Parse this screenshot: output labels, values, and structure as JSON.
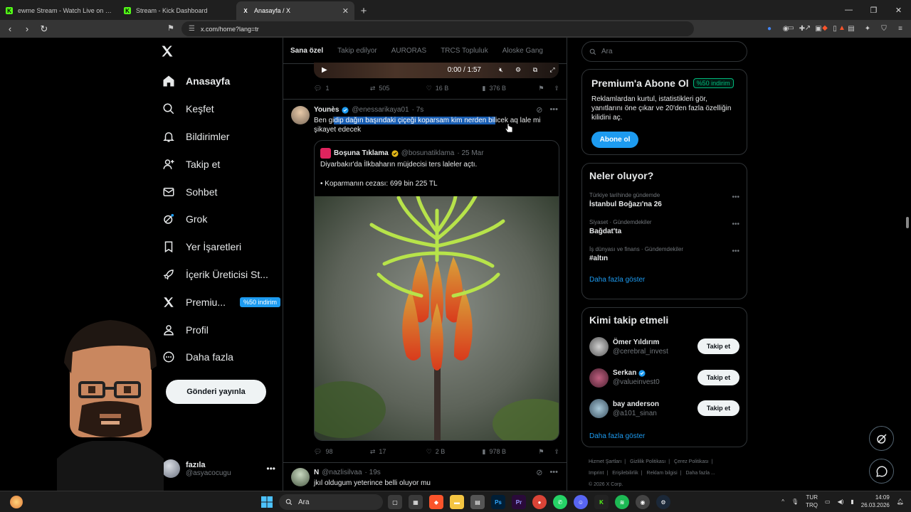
{
  "browser": {
    "tabs": [
      {
        "label": "ewme Stream - Watch Live on Kick",
        "fav_color": "#53fc18",
        "fav": "K"
      },
      {
        "label": "Stream - Kick Dashboard",
        "fav_color": "#53fc18",
        "fav": "K"
      },
      {
        "label": "Anasayfa / X",
        "fav_color": "#ffffff",
        "fav": "X"
      }
    ],
    "url": "x.com/home?lang=tr"
  },
  "nav": {
    "items": [
      {
        "label": "Anasayfa",
        "icon": "home-icon"
      },
      {
        "label": "Keşfet",
        "icon": "search-icon"
      },
      {
        "label": "Bildirimler",
        "icon": "bell-icon"
      },
      {
        "label": "Takip et",
        "icon": "add-user-icon"
      },
      {
        "label": "Sohbet",
        "icon": "mail-icon"
      },
      {
        "label": "Grok",
        "icon": "grok-icon"
      },
      {
        "label": "Yer İşaretleri",
        "icon": "bookmark-icon"
      },
      {
        "label": "İçerik Üreticisi St...",
        "icon": "rocket-icon"
      },
      {
        "label": "Premiu...",
        "icon": "x-icon"
      },
      {
        "label": "Profil",
        "icon": "person-icon"
      },
      {
        "label": "Daha fazla",
        "icon": "more-icon"
      }
    ],
    "premium_badge": "%50 indirim",
    "post_button": "Gönderi yayınla",
    "profile": {
      "name": "fazıla",
      "handle": "@asyacocugu"
    }
  },
  "feed": {
    "tabs": [
      "Sana özel",
      "Takip edilyor",
      "AURORAS",
      "TRCS Topluluk",
      "Aloske Gang"
    ],
    "video": {
      "time": "0:00 / 1:57"
    },
    "top_actions": {
      "replies": "1",
      "reposts": "505",
      "likes": "16 B",
      "views": "376 B"
    },
    "tweet": {
      "name": "Younès",
      "handle": "@enessarikaya01",
      "time": "· 7s",
      "text_pre": "Ben gi",
      "text_hl": "dip dağın başındaki çiçeği koparsam kim nerden bil",
      "text_post": "icek aq lale mi şikayet edecek",
      "quote": {
        "name": "Boşuna Tıklama",
        "handle": "@bosunatiklama",
        "time": "· 25 Mar",
        "line1": "Diyarbakır'da İlkbaharın müjdecisi ters laleler açtı.",
        "line2": "• Koparmanın cezası: 699 bin 225 TL"
      },
      "actions": {
        "replies": "98",
        "reposts": "17",
        "likes": "2 B",
        "views": "978 B"
      }
    },
    "next_tweet": {
      "name": "N",
      "handle": "@nazlisilvaa",
      "time": "· 19s",
      "text": "jkıl oldugum yeterince belli oluyor mu"
    }
  },
  "right": {
    "search_placeholder": "Ara",
    "premium": {
      "title": "Premium'a Abone Ol",
      "badge": "%50 indirim",
      "text": "Reklamlardan kurtul, istatistikleri gör, yanıtlarını öne çıkar ve 20'den fazla özelliğin kilidini aç.",
      "button": "Abone ol"
    },
    "trends": {
      "title": "Neler oluyor?",
      "items": [
        {
          "context": "Türkiye tarihinde gündemde",
          "name": "İstanbul Boğazı'na 26"
        },
        {
          "context": "Siyaset · Gündemdekiler",
          "name": "Bağdat'ta"
        },
        {
          "context": "İş dünyası ve finans · Gündemdekiler",
          "name": "#altın"
        }
      ],
      "show_more": "Daha fazla göster"
    },
    "who": {
      "title": "Kimi takip etmeli",
      "users": [
        {
          "name": "Ömer Yıldırım",
          "handle": "@cerebral_invest",
          "verified": false
        },
        {
          "name": "Serkan",
          "handle": "@valueinvest0",
          "verified": true
        },
        {
          "name": "bay anderson",
          "handle": "@a101_sinan",
          "verified": false
        }
      ],
      "follow_label": "Takip et",
      "show_more": "Daha fazla göster"
    },
    "footer": [
      "Hizmet Şartları",
      "|",
      "Gizlilik Politikası",
      "|",
      "Çerez Politikası",
      "|",
      "Imprint",
      "|",
      "Erişilebilirlik",
      "|",
      "Reklam bilgisi",
      "|",
      "Daha fazla ...",
      "© 2026 X Corp."
    ]
  },
  "taskbar": {
    "search": "Ara",
    "lang": "TUR",
    "lang2": "TRQ",
    "time": "14:09",
    "date": "26.03.2026",
    "apps": [
      {
        "label": "Ps",
        "color": "#001e36"
      },
      {
        "label": "Pr",
        "color": "#2a0a3a"
      },
      {
        "label": "",
        "color": "#db4437"
      },
      {
        "label": "",
        "color": "#25d366"
      },
      {
        "label": "",
        "color": "#5865f2"
      },
      {
        "label": "",
        "color": "#53fc18"
      },
      {
        "label": "",
        "color": "#1db954"
      },
      {
        "label": "",
        "color": "#444444"
      },
      {
        "label": "",
        "color": "#1b2838"
      }
    ]
  }
}
